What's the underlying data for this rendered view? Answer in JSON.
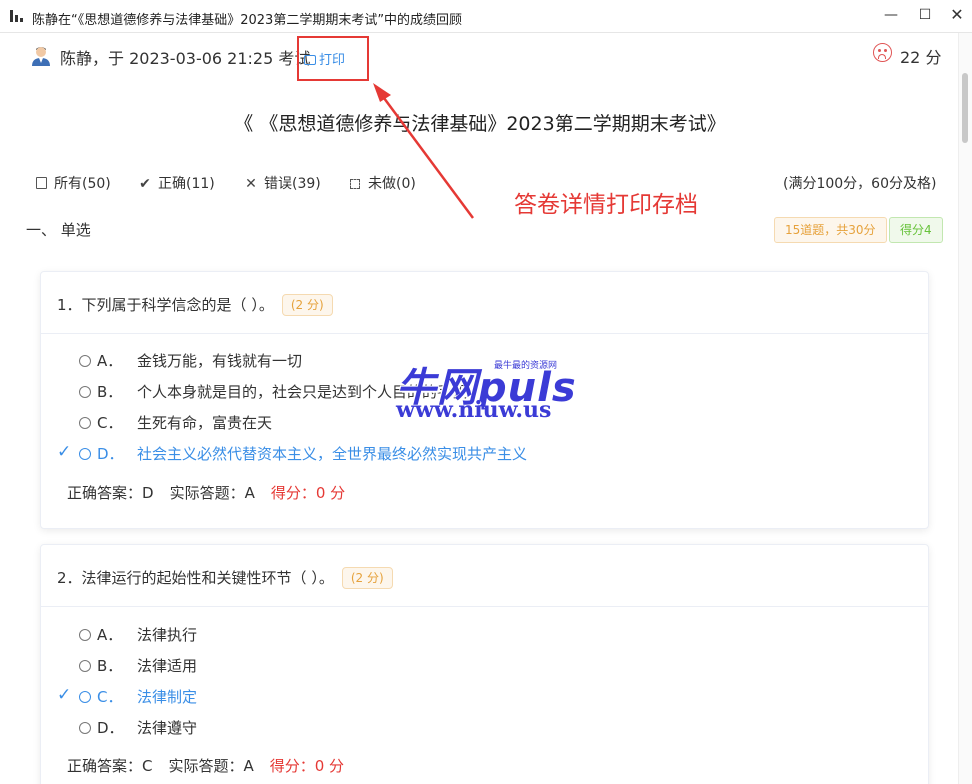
{
  "window": {
    "title": "陈静在“《思想道德修养与法律基础》2023第二学期期末考试”中的成绩回顾",
    "minimize": "—",
    "maximize": "☐",
    "close": "✕"
  },
  "header": {
    "user_line": "陈静，于 2023-03-06 21:25 考试",
    "print_label": "打印",
    "score": "22 分"
  },
  "exam": {
    "title": "《 《思想道德修养与法律基础》2023第二学期期末考试》"
  },
  "filters": {
    "all": "所有(50)",
    "correct": "正确(11)",
    "wrong": "错误(39)",
    "undone": "未做(0)",
    "pass_rule": "(满分100分，60分及格)"
  },
  "annotation": "答卷详情打印存档",
  "section": {
    "title": "一、 单选",
    "summary_tag": "15道题，共30分",
    "score_tag": "得分4"
  },
  "questions": [
    {
      "stem": "1．下列属于科学信念的是（ ）。",
      "points": "(2 分)",
      "options": [
        {
          "letter": "A．",
          "text": "金钱万能，有钱就有一切"
        },
        {
          "letter": "B．",
          "text": "个人本身就是目的，社会只是达到个人目的的手段"
        },
        {
          "letter": "C．",
          "text": "生死有命，富贵在天"
        },
        {
          "letter": "D．",
          "text": "社会主义必然代替资本主义，全世界最终必然实现共产主义"
        }
      ],
      "correct_answer": "正确答案：D",
      "actual_answer": "实际答题：A",
      "score": "得分：0 分"
    },
    {
      "stem": "2．法律运行的起始性和关键性环节（ ）。",
      "points": "(2 分)",
      "options": [
        {
          "letter": "A．",
          "text": "法律执行"
        },
        {
          "letter": "B．",
          "text": "法律适用"
        },
        {
          "letter": "C．",
          "text": "法律制定"
        },
        {
          "letter": "D．",
          "text": "法律遵守"
        }
      ],
      "correct_answer": "正确答案：C",
      "actual_answer": "实际答题：A",
      "score": "得分：0 分"
    }
  ],
  "watermark": {
    "brand": "牛网puls",
    "tagline": "最牛最的资源网",
    "url": "www.niuw.us"
  },
  "colors": {
    "accent": "#3a8ee6",
    "danger": "#e53935",
    "warning": "#e6a23c",
    "success": "#67c23a"
  }
}
